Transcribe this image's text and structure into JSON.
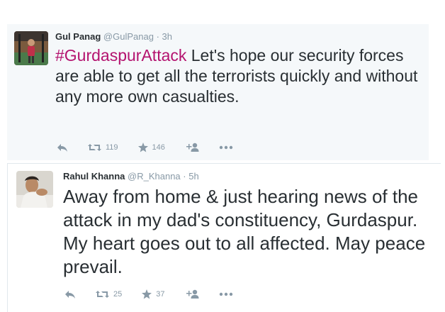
{
  "tweets": [
    {
      "name": "Gul Panag",
      "handle": "@GulPanag",
      "separator": "·",
      "time": "3h",
      "hashtag": "#GurdaspurAttack",
      "text": " Let's hope our security forces are able to get all the terrorists quickly and without any more own casualties.",
      "retweets": "119",
      "favorites": "146"
    },
    {
      "name": "Rahul Khanna",
      "handle": "@R_Khanna",
      "separator": "·",
      "time": "5h",
      "text": "Away from home & just hearing news of the attack in my dad's constituency, Gurdaspur. My heart goes out to all affected. May peace prevail.",
      "retweets": "25",
      "favorites": "37"
    }
  ],
  "icons": {
    "reply": "reply-icon",
    "retweet": "retweet-icon",
    "favorite": "star-icon",
    "follow": "follow-icon",
    "more": "more-icon"
  },
  "colors": {
    "hashtag": "#b4136f",
    "action_gray": "#8899a6",
    "text": "#292f33",
    "highlight_bg": "#f5f8fa"
  }
}
